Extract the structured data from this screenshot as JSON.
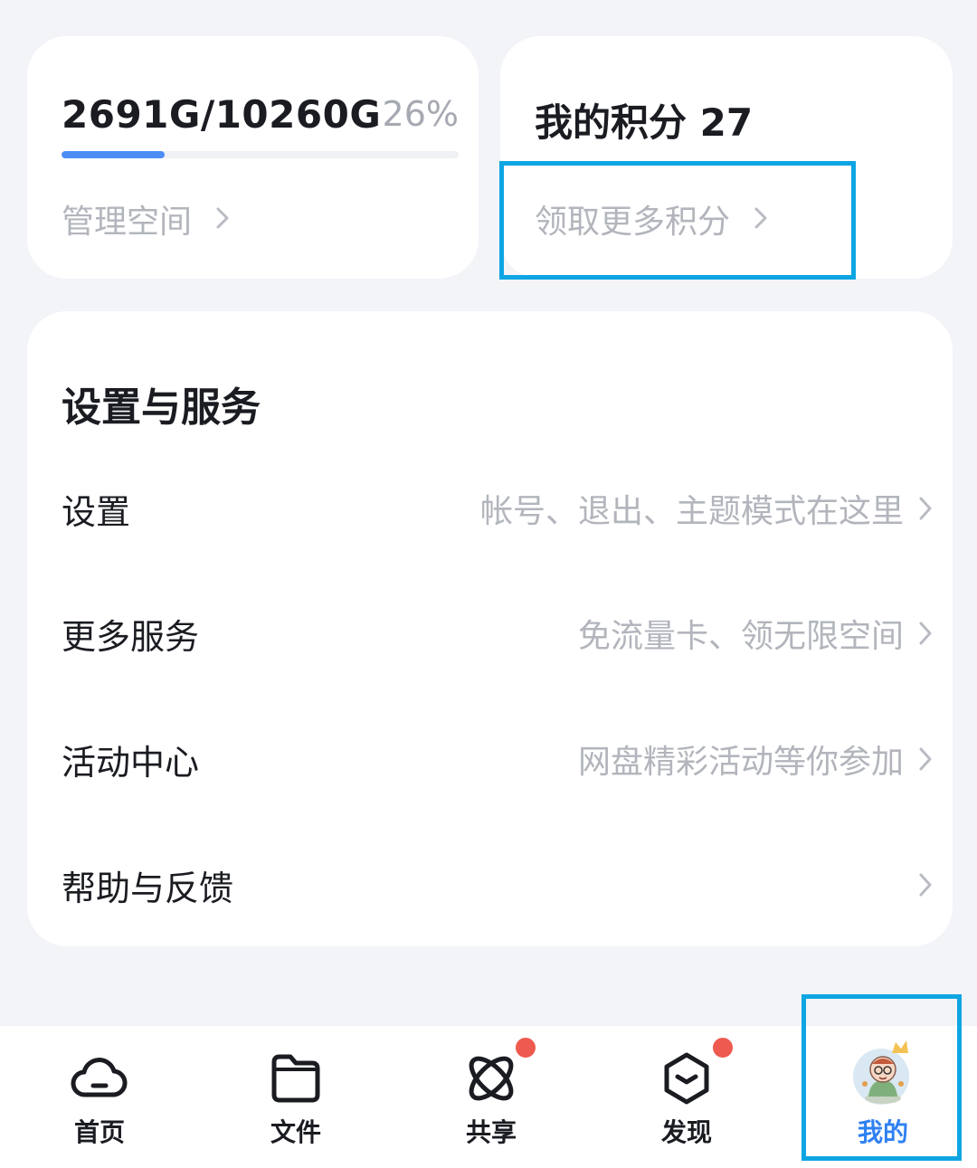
{
  "storage": {
    "usage_text": "2691G/10260G",
    "percent_text": "26%",
    "used_fraction": 0.26,
    "manage_label": "管理空间"
  },
  "points": {
    "title": "我的积分 27",
    "get_more_label": "领取更多积分"
  },
  "settings_section": {
    "title": "设置与服务",
    "items": [
      {
        "label": "设置",
        "desc": "帐号、退出、主题模式在这里"
      },
      {
        "label": "更多服务",
        "desc": "免流量卡、领无限空间"
      },
      {
        "label": "活动中心",
        "desc": "网盘精彩活动等你参加"
      },
      {
        "label": "帮助与反馈",
        "desc": ""
      }
    ]
  },
  "tabbar": {
    "tabs": [
      {
        "label": "首页",
        "icon": "cloud-icon",
        "badge": false,
        "active": false
      },
      {
        "label": "文件",
        "icon": "folder-icon",
        "badge": false,
        "active": false
      },
      {
        "label": "共享",
        "icon": "orbit-icon",
        "badge": true,
        "active": false
      },
      {
        "label": "发现",
        "icon": "cube-icon",
        "badge": true,
        "active": false
      },
      {
        "label": "我的",
        "icon": "avatar",
        "badge": false,
        "active": true
      }
    ]
  },
  "colors": {
    "accent": "#2f80f2",
    "progress": "#4c8df6",
    "badge": "#ee5a4f",
    "highlight_box": "#0ea5e3",
    "background": "#f3f4f8"
  }
}
